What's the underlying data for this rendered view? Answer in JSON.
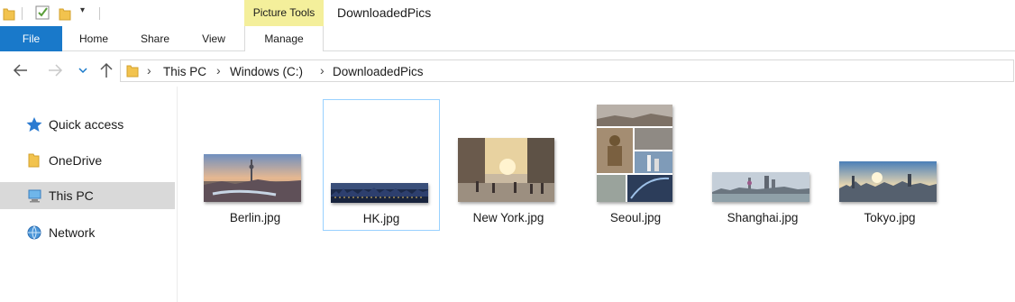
{
  "title": "DownloadedPics",
  "ribbon": {
    "context_group": "Picture Tools",
    "tabs": [
      "File",
      "Home",
      "Share",
      "View",
      "Manage"
    ]
  },
  "address": {
    "crumbs": [
      "This PC",
      "Windows (C:)",
      "DownloadedPics"
    ]
  },
  "nav": {
    "items": [
      "Quick access",
      "OneDrive",
      "This PC",
      "Network"
    ],
    "selected": "This PC"
  },
  "files": [
    {
      "name": "Berlin.jpg"
    },
    {
      "name": "HK.jpg"
    },
    {
      "name": "New York.jpg"
    },
    {
      "name": "Seoul.jpg"
    },
    {
      "name": "Shanghai.jpg"
    },
    {
      "name": "Tokyo.jpg"
    }
  ],
  "selected_file": "HK.jpg",
  "colors": {
    "accent": "#1979ca",
    "context_tab": "#f4ef9b",
    "nav_selected": "#d9d9d9",
    "file_selected_border": "#99d1ff"
  }
}
